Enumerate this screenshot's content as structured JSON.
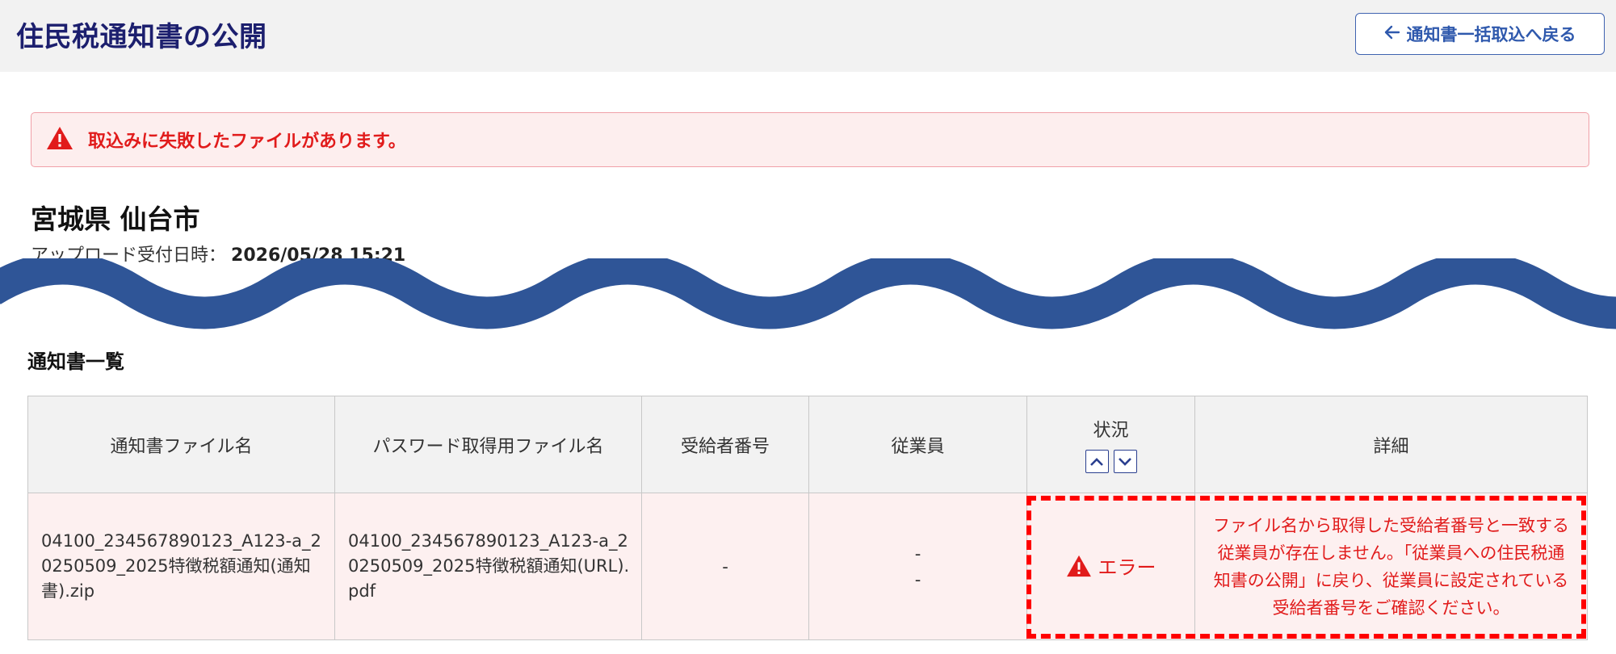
{
  "header": {
    "title": "住民税通知書の公開",
    "back_label": "通知書一括取込へ戻る"
  },
  "alert": {
    "message": "取込みに失敗したファイルがあります。"
  },
  "summary": {
    "city": "宮城県 仙台市",
    "upload_label": "アップロード受付日時：",
    "upload_value": "2026/05/28 15:21"
  },
  "section": {
    "title": "通知書一覧"
  },
  "table": {
    "headers": {
      "file_name": "通知書ファイル名",
      "password_file": "パスワード取得用ファイル名",
      "recipient_no": "受給者番号",
      "employee": "従業員",
      "status": "状況",
      "detail": "詳細"
    },
    "rows": [
      {
        "file_name": "04100_234567890123_A123-a_20250509_2025特徴税額通知(通知書).zip",
        "password_file": "04100_234567890123_A123-a_20250509_2025特徴税額通知(URL).pdf",
        "recipient_no": "-",
        "employee_line1": "-",
        "employee_line2": "-",
        "status": "エラー",
        "detail": "ファイル名から取得した受給者番号と一致する従業員が存在しません。「従業員への住民税通知書の公開」に戻り、従業員に設定されている受給者番号をご確認ください。"
      }
    ]
  },
  "icons": {
    "alert": "warning-triangle-icon",
    "back": "arrow-left-icon",
    "sort_up": "chevron-up-icon",
    "sort_down": "chevron-down-icon",
    "status": "warning-triangle-icon"
  },
  "colors": {
    "title": "#1c1f6e",
    "accent": "#2f59ad",
    "error": "#e11b1b",
    "alert_bg": "#fdeeee",
    "wave": "#2f5597"
  }
}
